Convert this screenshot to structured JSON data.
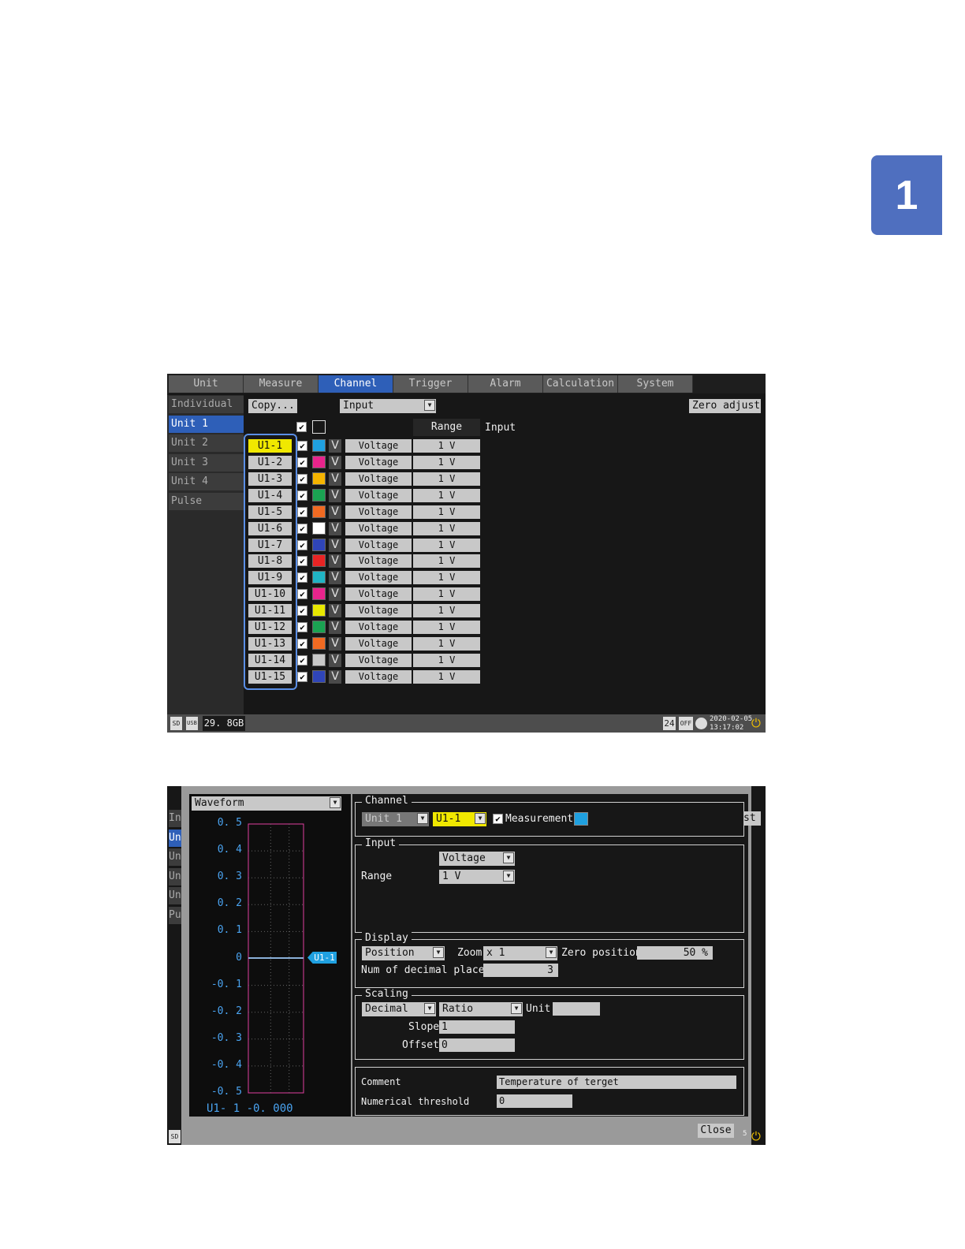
{
  "page_tab_number": "1",
  "screen1": {
    "tabs": [
      "Unit",
      "Measure",
      "Channel",
      "Trigger",
      "Alarm",
      "Calculation",
      "System"
    ],
    "sidebar": [
      "Individual",
      "Unit 1",
      "Unit 2",
      "Unit 3",
      "Unit 4",
      "Pulse"
    ],
    "copy_button": "Copy...",
    "view_select": "Input",
    "zero_adjust_button": "Zero adjust",
    "col_range": "Range",
    "col_input": "Input",
    "channels": [
      {
        "name": "U1-1",
        "color": "#1fa0e0",
        "mode": "Voltage",
        "range": "1 V"
      },
      {
        "name": "U1-2",
        "color": "#e8248c",
        "mode": "Voltage",
        "range": "1 V"
      },
      {
        "name": "U1-3",
        "color": "#f5b400",
        "mode": "Voltage",
        "range": "1 V"
      },
      {
        "name": "U1-4",
        "color": "#1aa352",
        "mode": "Voltage",
        "range": "1 V"
      },
      {
        "name": "U1-5",
        "color": "#f06a22",
        "mode": "Voltage",
        "range": "1 V"
      },
      {
        "name": "U1-6",
        "color": "#ffffff",
        "mode": "Voltage",
        "range": "1 V"
      },
      {
        "name": "U1-7",
        "color": "#2f45b8",
        "mode": "Voltage",
        "range": "1 V"
      },
      {
        "name": "U1-8",
        "color": "#e82424",
        "mode": "Voltage",
        "range": "1 V"
      },
      {
        "name": "U1-9",
        "color": "#20b4c4",
        "mode": "Voltage",
        "range": "1 V"
      },
      {
        "name": "U1-10",
        "color": "#e8248c",
        "mode": "Voltage",
        "range": "1 V"
      },
      {
        "name": "U1-11",
        "color": "#e8e800",
        "mode": "Voltage",
        "range": "1 V"
      },
      {
        "name": "U1-12",
        "color": "#1aa352",
        "mode": "Voltage",
        "range": "1 V"
      },
      {
        "name": "U1-13",
        "color": "#f06a22",
        "mode": "Voltage",
        "range": "1 V"
      },
      {
        "name": "U1-14",
        "color": "#c8c8c8",
        "mode": "Voltage",
        "range": "1 V"
      },
      {
        "name": "U1-15",
        "color": "#2f45b8",
        "mode": "Voltage",
        "range": "1 V"
      }
    ],
    "storage_free": "29. 8GB",
    "status_24": "24",
    "status_off": "OFF",
    "date": "2020-02-05",
    "time": "13:17:02",
    "accent": "#2e5fb8",
    "highlight": "#f0e800"
  },
  "screen2": {
    "sidebar_partial": [
      "In",
      "Un",
      "Un",
      "Un",
      "Un",
      "Pu"
    ],
    "right_partial": "st",
    "graph_select": "Waveform",
    "y_ticks": [
      "0. 5",
      "0. 4",
      "0. 3",
      "0. 2",
      "0. 1",
      "0",
      "-0. 1",
      "-0. 2",
      "-0. 3",
      "-0. 4",
      "-0. 5"
    ],
    "marker_label": "U1-1",
    "readout": "U1- 1 -0. 000",
    "channel_section": "Channel",
    "unit_select": "Unit 1",
    "channel_select": "U1-1",
    "measurement_label": "Measurement",
    "channel_color": "#1fa0e0",
    "input_section": "Input",
    "input_mode": "Voltage",
    "range_label": "Range",
    "range_value": "1 V",
    "display_section": "Display",
    "display_mode": "Position",
    "zoom_label": "Zoom",
    "zoom_value": "x 1",
    "zero_position_label": "Zero position",
    "zero_position_value": "50 %",
    "decimal_label": "Num of decimal places",
    "decimal_value": "3",
    "scaling_section": "Scaling",
    "scaling_notation": "Decimal",
    "scaling_mode": "Ratio",
    "unit_label": "Unit",
    "unit_value": "",
    "slope_label": "Slope",
    "slope_value": "1",
    "offset_label": "Offset",
    "offset_value": "0",
    "comment_label": "Comment",
    "comment_value": "Temperature of terget",
    "threshold_label": "Numerical threshold",
    "threshold_value": "0",
    "close_button": "Close",
    "status_partial": "5"
  }
}
